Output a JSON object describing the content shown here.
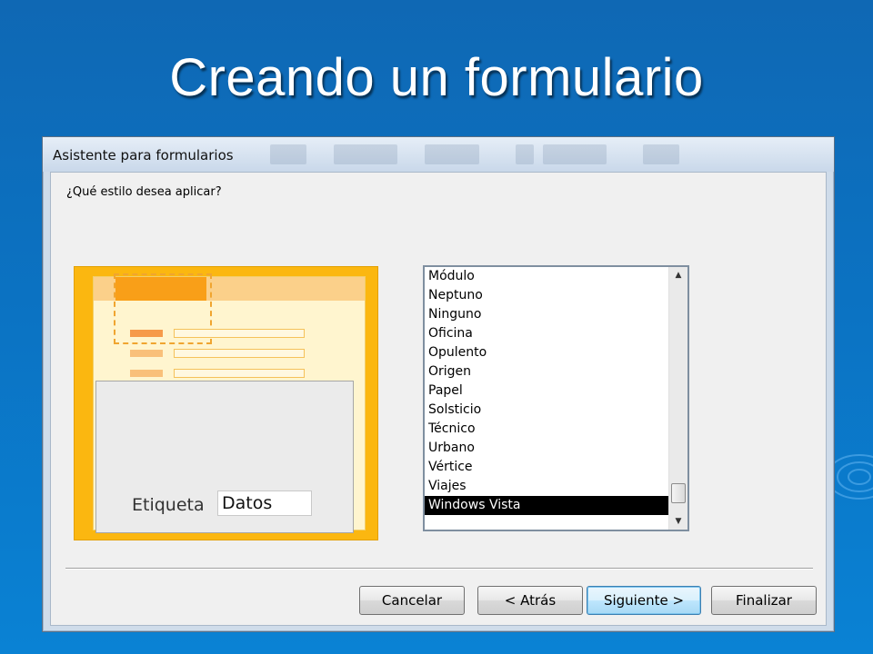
{
  "slide": {
    "title": "Creando un formulario"
  },
  "dialog": {
    "title": "Asistente para formularios",
    "question": "¿Qué estilo desea aplicar?",
    "preview": {
      "label": "Etiqueta",
      "field_value": "Datos"
    },
    "styles": [
      "Módulo",
      "Neptuno",
      "Ninguno",
      "Oficina",
      "Opulento",
      "Origen",
      "Papel",
      "Solsticio",
      "Técnico",
      "Urbano",
      "Vértice",
      "Viajes",
      "Windows Vista"
    ],
    "selected_style": "Windows Vista",
    "buttons": {
      "cancel": "Cancelar",
      "back": "< Atrás",
      "next": "Siguiente >",
      "finish": "Finalizar"
    }
  },
  "colors": {
    "slide_background": "#0b72c2",
    "preview_accent": "#fbb710",
    "selection": "#000000"
  },
  "icons": {
    "scroll_up": "scroll-up-arrow-icon",
    "scroll_down": "scroll-down-arrow-icon"
  }
}
